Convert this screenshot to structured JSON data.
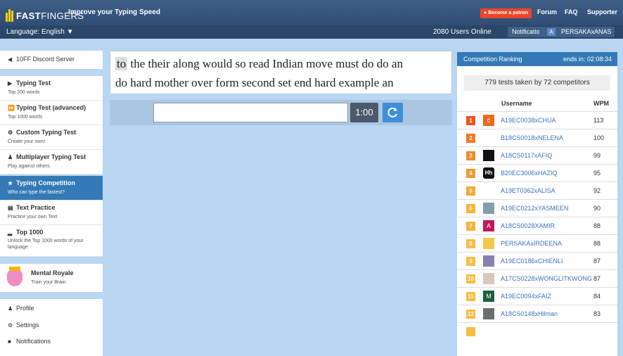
{
  "header": {
    "logo_bold": "FAST",
    "logo_thin": "FINGERS",
    "tagline": "Improve your Typing Speed",
    "patron_button": "Become a patron",
    "nav": [
      "Forum",
      "FAQ",
      "Supporter"
    ]
  },
  "subbar": {
    "language": "Language: English",
    "users_online": "2080 Users Online",
    "notifications": "Notifications",
    "user_initial": "A",
    "username": "PERSAKAxANAS"
  },
  "sidebar": {
    "discord": "10FF Discord Server",
    "items": [
      {
        "title": "Typing Test",
        "sub": "Top 200 words",
        "icon": "play-icon"
      },
      {
        "title": "Typing Test (advanced)",
        "sub": "Top 1000 words",
        "icon": "fast-forward-icon"
      },
      {
        "title": "Custom Typing Test",
        "sub": "Create your own!",
        "icon": "gears-icon"
      },
      {
        "title": "Multiplayer Typing Test",
        "sub": "Play against others",
        "icon": "users-icon"
      },
      {
        "title": "Typing Competition",
        "sub": "Who can type the fastest?",
        "icon": "trophy-icon"
      },
      {
        "title": "Text Practice",
        "sub": "Practice your own Text",
        "icon": "document-icon"
      },
      {
        "title": "Top 1000",
        "sub": "Unlock the Top 1000 words of your language",
        "icon": "bar-chart-icon"
      }
    ],
    "mental_title": "Mental Royale",
    "mental_sub": "Train your Brain",
    "bottom": [
      "Profile",
      "Settings",
      "Notifications"
    ]
  },
  "typing": {
    "current_word": "to",
    "line1_rest": "the their along would so read Indian move must do do an",
    "line2": "do hard mother over form second set end hard example an",
    "input_value": "",
    "timer": "1:00"
  },
  "ranking": {
    "title": "Competition Ranking",
    "ends": "ends in: 02:08:34",
    "tests_summary": "779 tests taken by 72 competitors",
    "col_username": "Username",
    "col_wpm": "WPM",
    "rows": [
      {
        "rank": "1",
        "user": "A19EC0038xCHUA",
        "wpm": "113",
        "avatar": "c"
      },
      {
        "rank": "2",
        "user": "B18CS0018xNELENA",
        "wpm": "100",
        "avatar": ""
      },
      {
        "rank": "3",
        "user": "A18CS0117xAFIQ",
        "wpm": "99",
        "avatar": ""
      },
      {
        "rank": "4",
        "user": "B20EC3006xHAZIQ",
        "wpm": "95",
        "avatar": "Hh"
      },
      {
        "rank": "5",
        "user": "A19ET0362xALISA",
        "wpm": "92",
        "avatar": ""
      },
      {
        "rank": "6",
        "user": "A19EC0212xYASMEEN",
        "wpm": "90",
        "avatar": ""
      },
      {
        "rank": "7",
        "user": "A18CS0028XAMIR",
        "wpm": "88",
        "avatar": "A"
      },
      {
        "rank": "8",
        "user": "PERSAKAxIRDEENA",
        "wpm": "88",
        "avatar": ""
      },
      {
        "rank": "9",
        "user": "A19EC0186xCHIENLI",
        "wpm": "87",
        "avatar": ""
      },
      {
        "rank": "10",
        "user": "A17CS0228xWONGLITKWONG",
        "wpm": "87",
        "avatar": ""
      },
      {
        "rank": "11",
        "user": "A19EC0094xFAIZ",
        "wpm": "84",
        "avatar": "M"
      },
      {
        "rank": "12",
        "user": "A18CS0148xHilman",
        "wpm": "83",
        "avatar": ""
      }
    ]
  },
  "colors": {
    "rank_orange": "#f0812d",
    "accent_blue": "#337ab7",
    "background": "#b9d6f2"
  }
}
